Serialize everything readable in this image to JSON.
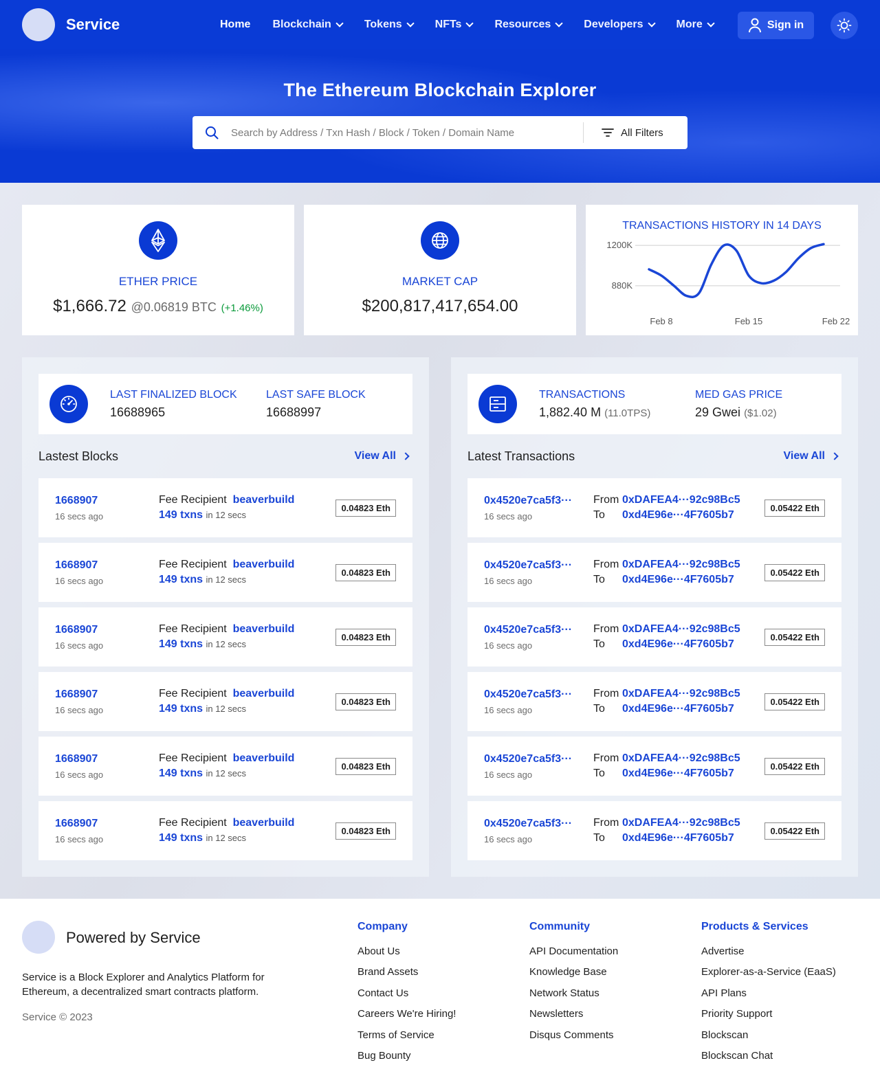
{
  "nav": {
    "brand": "Service",
    "items": [
      {
        "label": "Home",
        "dropdown": false,
        "active": true
      },
      {
        "label": "Blockchain",
        "dropdown": true
      },
      {
        "label": "Tokens",
        "dropdown": true
      },
      {
        "label": "NFTs",
        "dropdown": true
      },
      {
        "label": "Resources",
        "dropdown": true
      },
      {
        "label": "Developers",
        "dropdown": true
      },
      {
        "label": "More",
        "dropdown": true
      }
    ],
    "sign_in": "Sign in"
  },
  "hero": {
    "title": "The Ethereum Blockchain Explorer",
    "search_placeholder": "Search by Address / Txn Hash / Block / Token / Domain Name",
    "filters_label": "All Filters"
  },
  "stats": {
    "ether": {
      "label": "ETHER PRICE",
      "price": "$1,666.72",
      "btc": "@0.06819 BTC",
      "change": "(+1.46%)"
    },
    "market_cap": {
      "label": "MARKET CAP",
      "value": "$200,817,417,654.00"
    },
    "history": {
      "title": "TRANSACTIONS HISTORY IN 14 DAYS"
    }
  },
  "chart_data": {
    "type": "line",
    "title": "TRANSACTIONS HISTORY IN 14 DAYS",
    "y_tick_labels": [
      "1200K",
      "880K"
    ],
    "y_ticks": [
      1200000,
      880000
    ],
    "x_tick_labels": [
      "Feb 8",
      "Feb 15",
      "Feb 22"
    ],
    "x": [
      "Feb 8",
      "Feb 9",
      "Feb 10",
      "Feb 11",
      "Feb 12",
      "Feb 13",
      "Feb 14",
      "Feb 15",
      "Feb 16",
      "Feb 17",
      "Feb 18",
      "Feb 19",
      "Feb 20",
      "Feb 21",
      "Feb 22"
    ],
    "values": [
      1010000,
      960000,
      880000,
      800000,
      820000,
      1050000,
      1200000,
      1160000,
      960000,
      900000,
      920000,
      990000,
      1100000,
      1180000,
      1210000
    ],
    "ylim": [
      650000,
      1250000
    ],
    "grid": true
  },
  "blocks_panel": {
    "finalized_label": "LAST FINALIZED BLOCK",
    "finalized_value": "16688965",
    "safe_label": "LAST SAFE BLOCK",
    "safe_value": "16688997",
    "title": "Lastest Blocks",
    "view_all": "View All",
    "rows": [
      {
        "block": "1668907",
        "ago": "16 secs ago",
        "fee_label": "Fee Recipient",
        "recipient": "beaverbuild",
        "txns": "149 txns",
        "in": "in 12 secs",
        "reward": "0.04823 Eth"
      },
      {
        "block": "1668907",
        "ago": "16 secs ago",
        "fee_label": "Fee Recipient",
        "recipient": "beaverbuild",
        "txns": "149 txns",
        "in": "in 12 secs",
        "reward": "0.04823 Eth"
      },
      {
        "block": "1668907",
        "ago": "16 secs ago",
        "fee_label": "Fee Recipient",
        "recipient": "beaverbuild",
        "txns": "149 txns",
        "in": "in 12 secs",
        "reward": "0.04823 Eth"
      },
      {
        "block": "1668907",
        "ago": "16 secs ago",
        "fee_label": "Fee Recipient",
        "recipient": "beaverbuild",
        "txns": "149 txns",
        "in": "in 12 secs",
        "reward": "0.04823 Eth"
      },
      {
        "block": "1668907",
        "ago": "16 secs ago",
        "fee_label": "Fee Recipient",
        "recipient": "beaverbuild",
        "txns": "149 txns",
        "in": "in 12 secs",
        "reward": "0.04823 Eth"
      },
      {
        "block": "1668907",
        "ago": "16 secs ago",
        "fee_label": "Fee Recipient",
        "recipient": "beaverbuild",
        "txns": "149 txns",
        "in": "in 12 secs",
        "reward": "0.04823 Eth"
      }
    ]
  },
  "tx_panel": {
    "tx_label": "TRANSACTIONS",
    "tx_value": "1,882.40 M",
    "tx_tps": "(11.0TPS)",
    "gas_label": "MED GAS PRICE",
    "gas_value": "29 Gwei",
    "gas_usd": "($1.02)",
    "title": "Latest Transactions",
    "view_all": "View All",
    "rows": [
      {
        "hash": "0x4520e7ca5f3···",
        "ago": "16 secs ago",
        "from_label": "From",
        "from": "0xDAFEA4···92c98Bc5",
        "to_label": "To",
        "to": "0xd4E96e···4F7605b7",
        "value": "0.05422 Eth"
      },
      {
        "hash": "0x4520e7ca5f3···",
        "ago": "16 secs ago",
        "from_label": "From",
        "from": "0xDAFEA4···92c98Bc5",
        "to_label": "To",
        "to": "0xd4E96e···4F7605b7",
        "value": "0.05422 Eth"
      },
      {
        "hash": "0x4520e7ca5f3···",
        "ago": "16 secs ago",
        "from_label": "From",
        "from": "0xDAFEA4···92c98Bc5",
        "to_label": "To",
        "to": "0xd4E96e···4F7605b7",
        "value": "0.05422 Eth"
      },
      {
        "hash": "0x4520e7ca5f3···",
        "ago": "16 secs ago",
        "from_label": "From",
        "from": "0xDAFEA4···92c98Bc5",
        "to_label": "To",
        "to": "0xd4E96e···4F7605b7",
        "value": "0.05422 Eth"
      },
      {
        "hash": "0x4520e7ca5f3···",
        "ago": "16 secs ago",
        "from_label": "From",
        "from": "0xDAFEA4···92c98Bc5",
        "to_label": "To",
        "to": "0xd4E96e···4F7605b7",
        "value": "0.05422 Eth"
      },
      {
        "hash": "0x4520e7ca5f3···",
        "ago": "16 secs ago",
        "from_label": "From",
        "from": "0xDAFEA4···92c98Bc5",
        "to_label": "To",
        "to": "0xd4E96e···4F7605b7",
        "value": "0.05422 Eth"
      }
    ]
  },
  "footer": {
    "brand": "Powered by Service",
    "description": "Service is a Block Explorer and Analytics Platform for Ethereum, a decentralized smart contracts platform.",
    "copyright": "Service © 2023",
    "company": {
      "title": "Company",
      "links": [
        "About Us",
        "Brand Assets",
        "Contact Us",
        "Careers We're Hiring!",
        "Terms of Service",
        "Bug Bounty"
      ]
    },
    "community": {
      "title": "Community",
      "links": [
        "API Documentation",
        "Knowledge Base",
        "Network Status",
        "Newsletters",
        "Disqus Comments"
      ]
    },
    "products": {
      "title": "Products & Services",
      "links": [
        "Advertise",
        "Explorer-as-a-Service (EaaS)",
        "API Plans",
        "Priority Support",
        "Blockscan",
        "Blockscan Chat"
      ]
    }
  },
  "colors": {
    "brand_blue": "#0a3ad4",
    "link_blue": "#1a46d6",
    "positive": "#0a9a3a"
  },
  "icons": [
    "user-icon",
    "sun-icon",
    "search-icon",
    "filter-icon",
    "ethereum-icon",
    "globe-icon",
    "speedometer-icon",
    "server-icon",
    "chevron-down-icon",
    "chevron-right-icon"
  ]
}
